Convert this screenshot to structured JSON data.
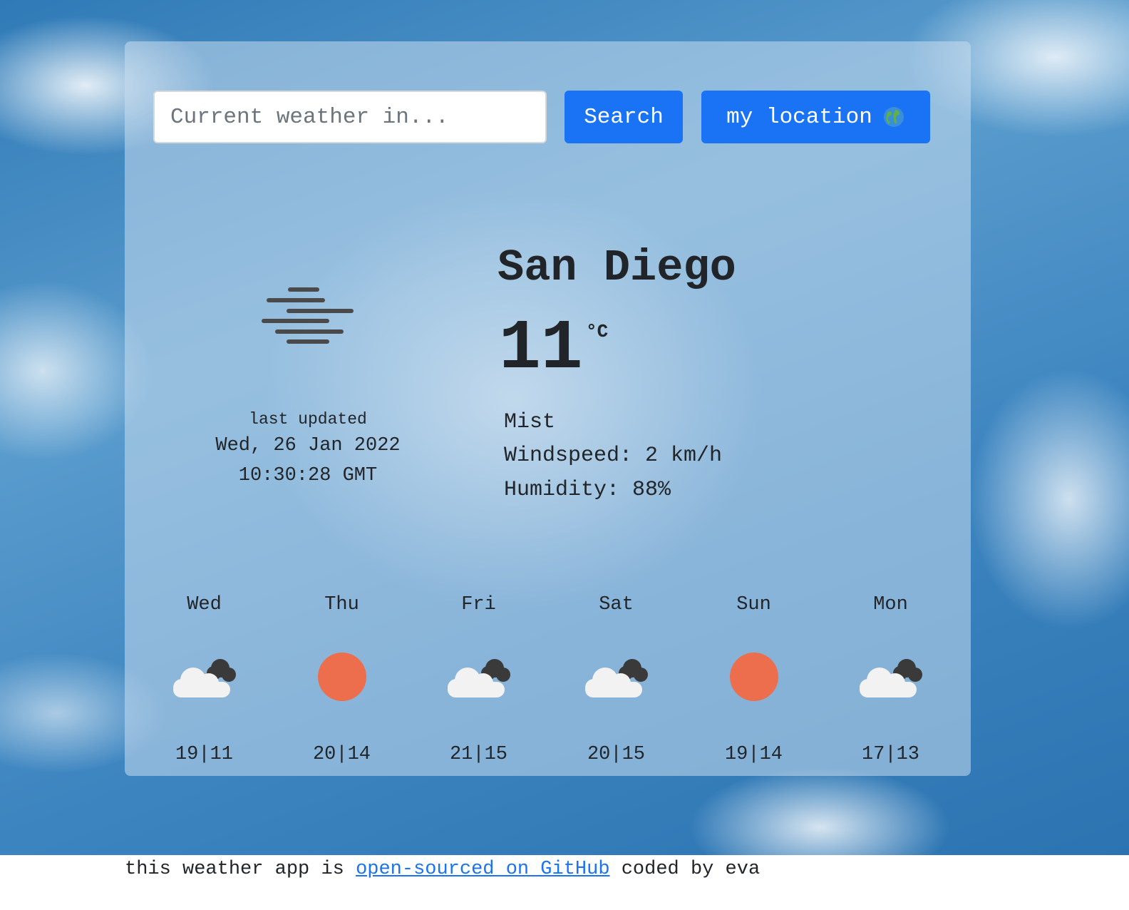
{
  "search": {
    "placeholder": "Current weather in...",
    "button_label": "Search"
  },
  "location_button": {
    "label": "my location",
    "icon": "globe-icon"
  },
  "current": {
    "city": "San Diego",
    "temperature": "11",
    "unit": "°C",
    "description": "Mist",
    "windspeed": "Windspeed: 2 km/h",
    "humidity": "Humidity: 88%",
    "icon": "mist-icon"
  },
  "last_updated": {
    "label": "last updated",
    "date": "Wed, 26 Jan 2022",
    "time": "10:30:28 GMT"
  },
  "forecast": [
    {
      "day": "Wed",
      "temps": "19|11",
      "icon": "cloudy-icon"
    },
    {
      "day": "Thu",
      "temps": "20|14",
      "icon": "sun-icon"
    },
    {
      "day": "Fri",
      "temps": "21|15",
      "icon": "cloudy-icon"
    },
    {
      "day": "Sat",
      "temps": "20|15",
      "icon": "cloudy-icon"
    },
    {
      "day": "Sun",
      "temps": "19|14",
      "icon": "sun-icon"
    },
    {
      "day": "Mon",
      "temps": "17|13",
      "icon": "cloudy-icon"
    }
  ],
  "footer": {
    "prefix": "this weather app is",
    "link_text": "open-sourced on GitHub",
    "suffix": "coded by eva"
  },
  "colors": {
    "accent": "#1a73f5",
    "sun": "#ec6e4c",
    "text": "#212529"
  }
}
